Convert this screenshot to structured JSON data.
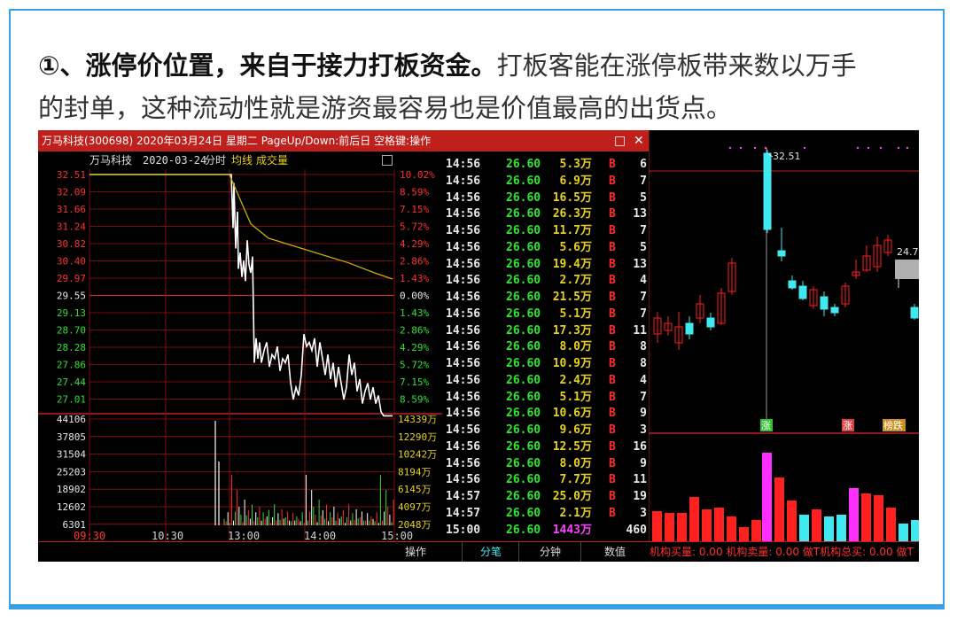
{
  "paragraph": {
    "bold": "①、涨停价位置，来自于接力打板资金。",
    "rest_line1": "打板客能在涨停板带来数以万手",
    "line2": "的封单，这种流动性就是游资最容易也是价值最高的出货点。"
  },
  "window": {
    "title": "万马科技(300698) 2020年03月24日 星期二 PageUp/Down:前后日 空格键:操作",
    "restore_icon": "□",
    "close_icon": "✕"
  },
  "intraday": {
    "stock_name": "万马科技",
    "date": "2020-03-24",
    "mode": "分时",
    "avg_line_label": "均线",
    "volume_label": "成交量",
    "price_ticks": [
      "32.51",
      "32.09",
      "31.66",
      "31.24",
      "30.82",
      "30.40",
      "29.97",
      "29.55",
      "29.13",
      "28.70",
      "28.28",
      "27.86",
      "27.44",
      "27.01"
    ],
    "pct_ticks": [
      "10.02%",
      "8.59%",
      "7.15%",
      "5.72%",
      "4.29%",
      "2.86%",
      "1.43%",
      "0.00%",
      "1.43%",
      "2.86%",
      "4.29%",
      "5.72%",
      "7.15%",
      "8.59%"
    ],
    "volume_ticks": [
      "44106",
      "37805",
      "31504",
      "25203",
      "18902",
      "12602",
      "6301"
    ],
    "volume_right_ticks": [
      "14339万",
      "12290万",
      "10242万",
      "8194万",
      "6145万",
      "4097万",
      "2048万"
    ],
    "time_labels": [
      "09:30",
      "10:30",
      "13:00",
      "14:00",
      "15:00"
    ],
    "colors": {
      "up": "#ff3030",
      "down": "#30e030",
      "price_line": "#ffffff",
      "avg_line": "#c8b000",
      "grid": "#a01010"
    }
  },
  "ticks": {
    "rows": [
      {
        "time": "14:56",
        "price": "26.60",
        "vol": "5.3万",
        "side": "B",
        "count": "6"
      },
      {
        "time": "14:56",
        "price": "26.60",
        "vol": "6.9万",
        "side": "B",
        "count": "7"
      },
      {
        "time": "14:56",
        "price": "26.60",
        "vol": "16.5万",
        "side": "B",
        "count": "5"
      },
      {
        "time": "14:56",
        "price": "26.60",
        "vol": "26.3万",
        "side": "B",
        "count": "13"
      },
      {
        "time": "14:56",
        "price": "26.60",
        "vol": "11.7万",
        "side": "B",
        "count": "7"
      },
      {
        "time": "14:56",
        "price": "26.60",
        "vol": "5.6万",
        "side": "B",
        "count": "5"
      },
      {
        "time": "14:56",
        "price": "26.60",
        "vol": "19.4万",
        "side": "B",
        "count": "13"
      },
      {
        "time": "14:56",
        "price": "26.60",
        "vol": "2.7万",
        "side": "B",
        "count": "4"
      },
      {
        "time": "14:56",
        "price": "26.60",
        "vol": "21.5万",
        "side": "B",
        "count": "7"
      },
      {
        "time": "14:56",
        "price": "26.60",
        "vol": "5.1万",
        "side": "B",
        "count": "7"
      },
      {
        "time": "14:56",
        "price": "26.60",
        "vol": "17.3万",
        "side": "B",
        "count": "11"
      },
      {
        "time": "14:56",
        "price": "26.60",
        "vol": "8.0万",
        "side": "B",
        "count": "8"
      },
      {
        "time": "14:56",
        "price": "26.60",
        "vol": "10.9万",
        "side": "B",
        "count": "8"
      },
      {
        "time": "14:56",
        "price": "26.60",
        "vol": "2.4万",
        "side": "B",
        "count": "4"
      },
      {
        "time": "14:56",
        "price": "26.60",
        "vol": "5.1万",
        "side": "B",
        "count": "7"
      },
      {
        "time": "14:56",
        "price": "26.60",
        "vol": "10.6万",
        "side": "B",
        "count": "9"
      },
      {
        "time": "14:56",
        "price": "26.60",
        "vol": "9.6万",
        "side": "B",
        "count": "3"
      },
      {
        "time": "14:56",
        "price": "26.60",
        "vol": "12.5万",
        "side": "B",
        "count": "16"
      },
      {
        "time": "14:56",
        "price": "26.60",
        "vol": "8.0万",
        "side": "B",
        "count": "9"
      },
      {
        "time": "14:56",
        "price": "26.60",
        "vol": "7.7万",
        "side": "B",
        "count": "11"
      },
      {
        "time": "14:57",
        "price": "26.60",
        "vol": "25.0万",
        "side": "B",
        "count": "19"
      },
      {
        "time": "14:57",
        "price": "26.60",
        "vol": "2.1万",
        "side": "B",
        "count": "3"
      },
      {
        "time": "15:00",
        "price": "26.60",
        "vol": "1443万",
        "side": "",
        "count": "460"
      }
    ]
  },
  "kline": {
    "high_label": "32.51",
    "price_label": "24.7",
    "tags": [
      "涨",
      "涨",
      "榜跌"
    ],
    "colors": {
      "up": "#ff2020",
      "down": "#40e8f0",
      "highlight": "#ff30ff"
    }
  },
  "bottom_bar": {
    "op_label": "操作",
    "tabs": [
      "分笔",
      "分钟",
      "数值"
    ],
    "stats": "机构买量: 0.00  机构卖量: 0.00  做T机构总买: 0.00  做T"
  }
}
